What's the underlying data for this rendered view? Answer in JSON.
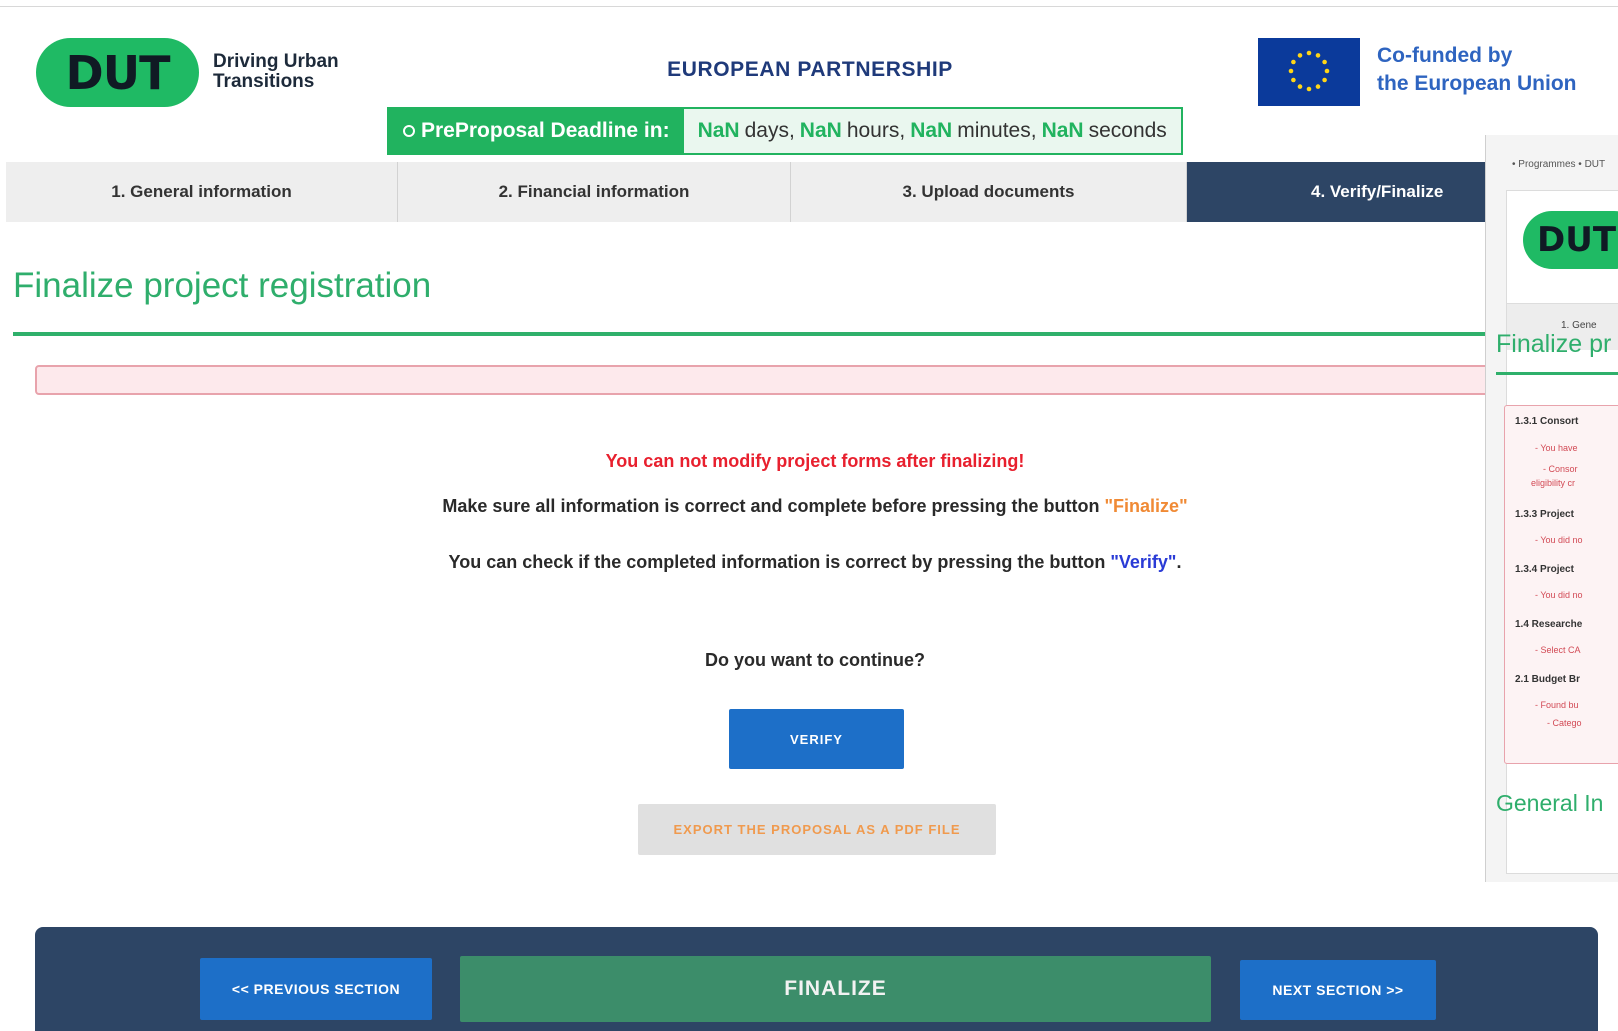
{
  "header": {
    "logo_mark": "DUT",
    "logo_line1": "Driving Urban",
    "logo_line2": "Transitions",
    "partnership": "EUROPEAN PARTNERSHIP",
    "eu_line1": "Co-funded by",
    "eu_line2": "the European Union"
  },
  "deadline": {
    "label": "PreProposal Deadline in:",
    "days_value": "NaN",
    "days_unit": "days,",
    "hours_value": "NaN",
    "hours_unit": "hours,",
    "minutes_value": "NaN",
    "minutes_unit": "minutes,",
    "seconds_value": "NaN",
    "seconds_unit": "seconds"
  },
  "tabs": [
    {
      "label": "1. General information"
    },
    {
      "label": "2. Financial information"
    },
    {
      "label": "3. Upload documents"
    },
    {
      "label": "4. Verify/Finalize",
      "active": true
    }
  ],
  "main": {
    "title": "Finalize project registration",
    "warning": "You can not modify project forms after finalizing!",
    "line1_pre": "Make sure all information is correct and complete before pressing the button ",
    "line1_quote": "\"Finalize\"",
    "line2_pre": "You can check if the completed information is correct by pressing the button ",
    "line2_quote": "\"Verify\"",
    "line2_post": ".",
    "question": "Do you want to continue?",
    "verify_label": "VERIFY",
    "export_label": "EXPORT THE PROPOSAL AS A PDF FILE"
  },
  "footer": {
    "prev_label": "<< PREVIOUS SECTION",
    "finalize_label": "FINALIZE",
    "next_label": "NEXT SECTION >>"
  },
  "inset": {
    "breadcrumb": "• Programmes • DUT",
    "logo_mark": "DUT",
    "tab_label": "1. Gene",
    "title": "Finalize pr",
    "errors": [
      {
        "head": "1.3.1 Consort",
        "subs": [
          "- You have",
          "- Consor",
          "eligibility cr"
        ]
      },
      {
        "head": "1.3.3 Project",
        "subs": [
          "- You did no"
        ]
      },
      {
        "head": "1.3.4 Project",
        "subs": [
          "- You did no"
        ]
      },
      {
        "head": "1.4 Researche",
        "subs": [
          "- Select CA"
        ]
      },
      {
        "head": "2.1 Budget Br",
        "subs": [
          "- Found bu",
          "- Catego"
        ]
      }
    ],
    "general": "General In"
  },
  "colors": {
    "brand_green": "#1fba64",
    "nav_dark": "#2d4565",
    "button_blue": "#1d6fc8",
    "warning_red": "#e8202e",
    "finalize_green": "#3c8d6a"
  }
}
